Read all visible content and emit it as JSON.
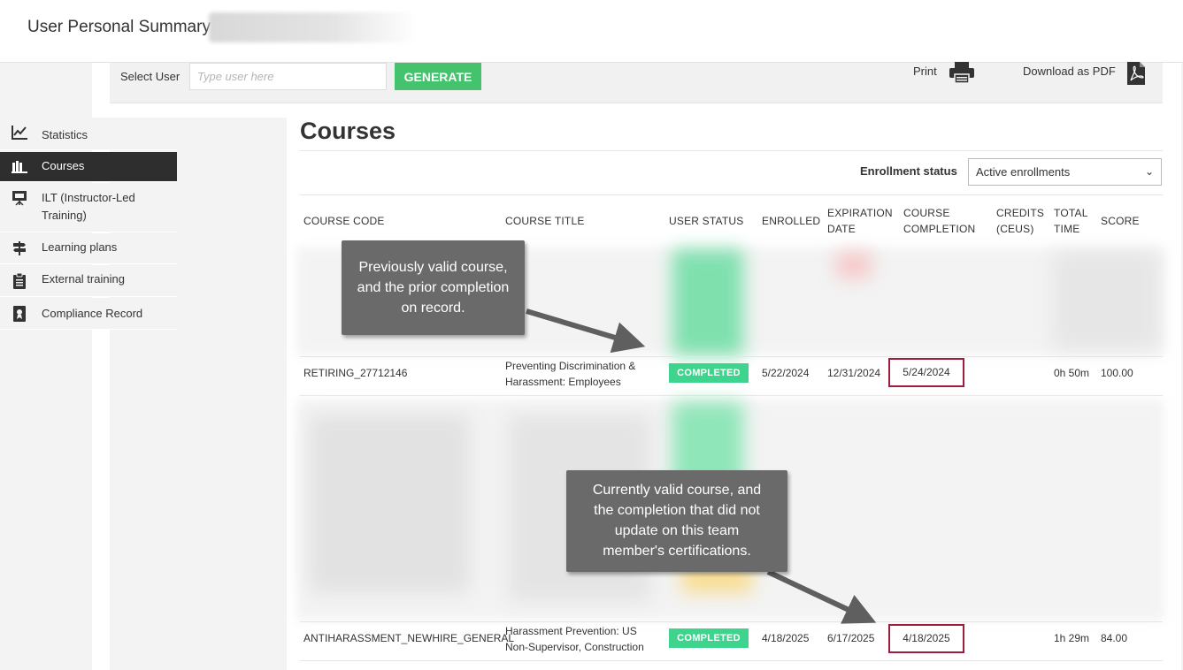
{
  "header": {
    "title": "User Personal Summary:"
  },
  "toolbar": {
    "select_user_label": "Select User",
    "user_input_placeholder": "Type user here",
    "generate_label": "GENERATE",
    "print_label": "Print",
    "pdf_label": "Download as PDF"
  },
  "sidebar": {
    "items": [
      {
        "label": "Statistics",
        "icon": "chart-icon"
      },
      {
        "label": "Courses",
        "icon": "courses-icon",
        "active": true
      },
      {
        "label": "ILT (Instructor-Led Training)",
        "icon": "presentation-icon"
      },
      {
        "label": "Learning plans",
        "icon": "signpost-icon"
      },
      {
        "label": "External training",
        "icon": "clipboard-icon"
      },
      {
        "label": "Compliance Record",
        "icon": "certificate-icon"
      }
    ]
  },
  "main": {
    "title": "Courses",
    "enrollment_status_label": "Enrollment status",
    "enrollment_status_value": "Active enrollments",
    "columns": [
      "COURSE CODE",
      "COURSE TITLE",
      "USER STATUS",
      "ENROLLED",
      "EXPIRATION DATE",
      "COURSE COMPLETION",
      "CREDITS (CEUS)",
      "TOTAL TIME",
      "SCORE"
    ],
    "rows": [
      {
        "code": "RETIRING_27712146",
        "title_line1": "Preventing Discrimination &",
        "title_line2": "Harassment: Employees",
        "status": "COMPLETED",
        "enrolled": "5/22/2024",
        "expiration": "12/31/2024",
        "completion": "5/24/2024",
        "credits": "",
        "total_time": "0h 50m",
        "score": "100.00"
      },
      {
        "code": "ANTIHARASSMENT_NEWHIRE_GENERAL",
        "title_line1": "Harassment Prevention: US",
        "title_line2": "Non-Supervisor, Construction",
        "status": "COMPLETED",
        "enrolled": "4/18/2025",
        "expiration": "6/17/2025",
        "completion": "4/18/2025",
        "credits": "",
        "total_time": "1h 29m",
        "score": "84.00"
      }
    ]
  },
  "annotations": {
    "callout1": [
      "Previously valid course,",
      "and the prior completion",
      "on record."
    ],
    "callout2": [
      "Currently valid course, and",
      "the completion that did not",
      "update on this team",
      "member's certifications."
    ]
  },
  "colors": {
    "accent_green": "#44c26d",
    "badge_green": "#3fd48e",
    "highlight_border": "#9c1d3e",
    "callout_bg": "#6a6a6a"
  }
}
